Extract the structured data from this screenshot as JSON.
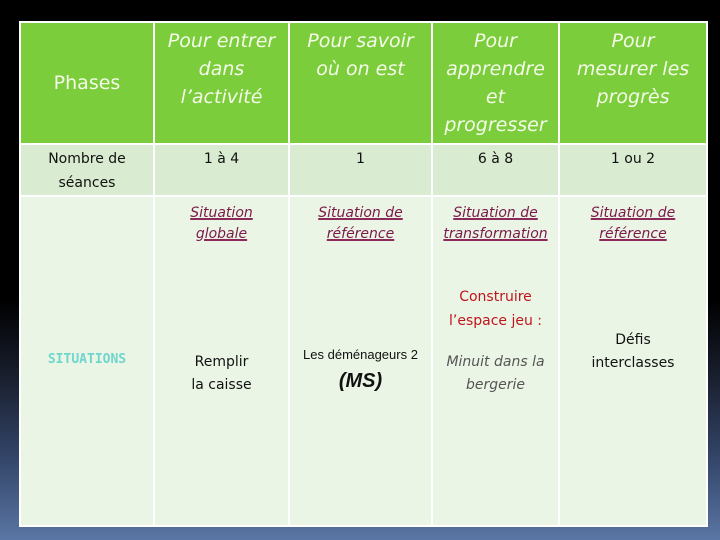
{
  "table": {
    "header": {
      "phases": "Phases",
      "col1": [
        "Pour entrer",
        "dans",
        "l’activité"
      ],
      "col2": [
        "Pour savoir",
        "où on est"
      ],
      "col3": [
        "Pour",
        "apprendre",
        "et",
        "progresser"
      ],
      "col4": [
        "Pour",
        "mesurer les",
        "progrès"
      ]
    },
    "sessions": {
      "label": [
        "Nombre de",
        "séances"
      ],
      "values": [
        "1 à 4",
        "1",
        "6 à 8",
        "1 ou 2"
      ]
    },
    "situations": {
      "label": "SITUATIONS",
      "types": [
        [
          "Situation",
          "globale"
        ],
        [
          "Situation de",
          "référence"
        ],
        [
          "Situation de",
          "transformation"
        ],
        [
          "Situation de",
          "référence"
        ]
      ],
      "col1_activity": [
        "Remplir",
        "la caisse"
      ],
      "col2_activity": "Les déménageurs 2",
      "col2_level": "(MS)",
      "col3_heading": [
        "Construire",
        "l’espace jeu :"
      ],
      "col3_activity": [
        "Minuit dans la",
        "bergerie"
      ],
      "col4_activity": [
        "Défis",
        "interclasses"
      ]
    }
  },
  "colors": {
    "header_green": "#7ccd3c",
    "row_light_green": "#d9ebd0",
    "cell_pale_green": "#ebf5e6",
    "link_purple": "#7a1a4a",
    "heading_red": "#c0141c",
    "situations_teal": "#6fd6cc"
  }
}
